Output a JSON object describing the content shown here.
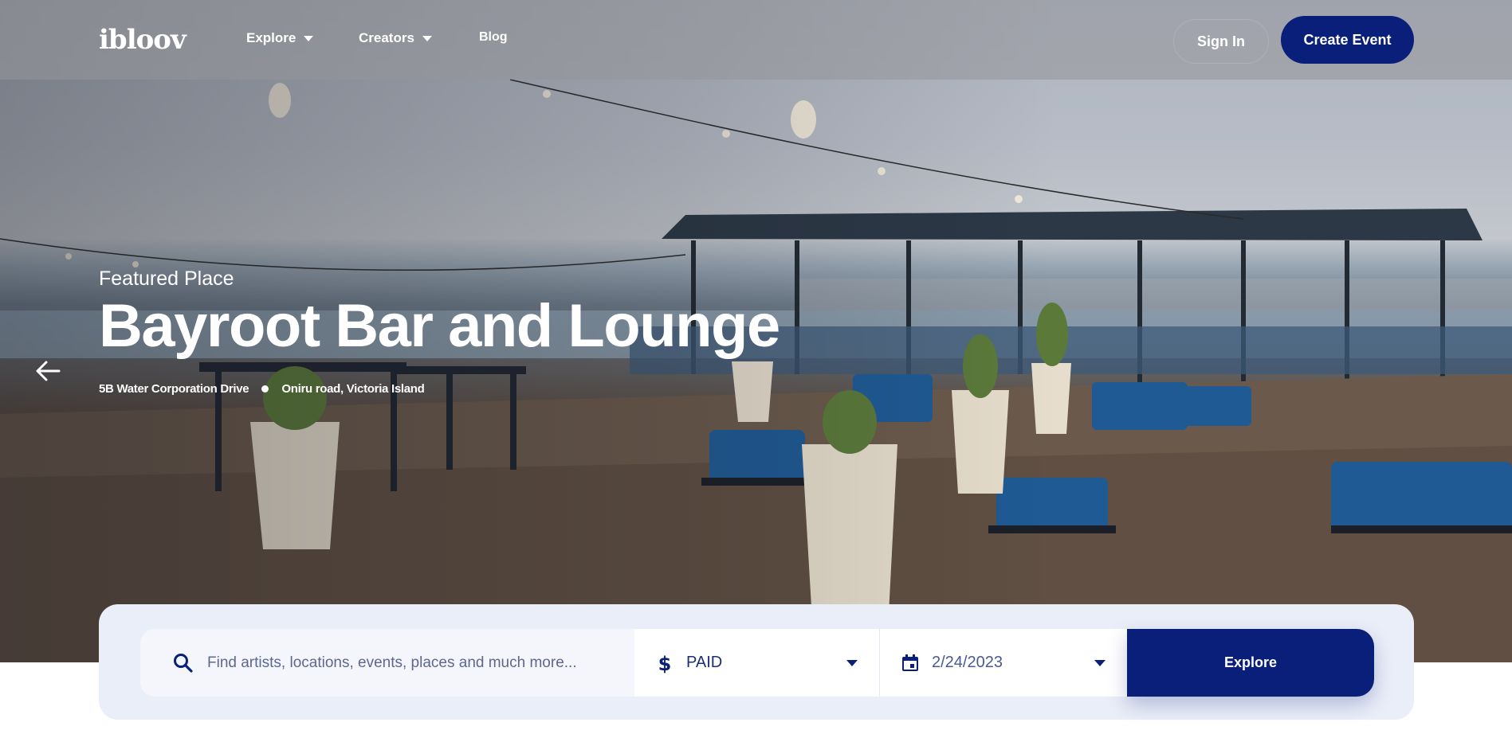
{
  "brand": {
    "logo_text": "ibloov"
  },
  "nav": {
    "items": [
      {
        "label": "Explore",
        "has_dropdown": true
      },
      {
        "label": "Creators",
        "has_dropdown": true
      },
      {
        "label": "Blog",
        "has_dropdown": false
      }
    ],
    "sign_in_label": "Sign In",
    "create_event_label": "Create Event"
  },
  "hero": {
    "eyebrow": "Featured Place",
    "title": "Bayroot Bar and Lounge",
    "address_line1": "5B Water Corporation Drive",
    "address_line2": "Oniru road, Victoria Island",
    "prev_icon": "arrow-left-icon"
  },
  "search": {
    "placeholder": "Find artists, locations, events, places and much more...",
    "price": {
      "icon": "dollar-icon",
      "value": "PAID"
    },
    "date": {
      "icon": "calendar-icon",
      "value": "2/24/2023"
    },
    "submit_label": "Explore"
  },
  "colors": {
    "accent": "#0a1f7a",
    "panel_bg": "#eaeef8",
    "nav_overlay": "rgba(150,150,155,0.55)"
  }
}
